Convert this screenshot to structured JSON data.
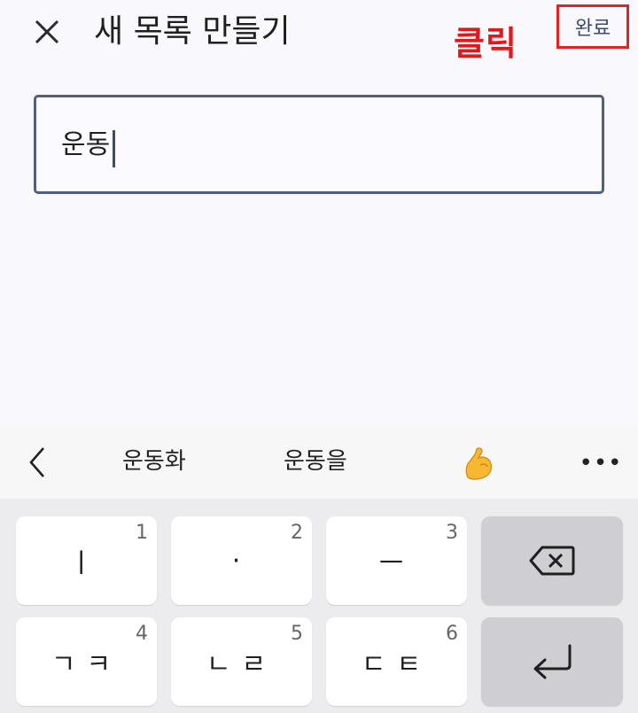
{
  "header": {
    "title": "새 목록 만들기",
    "close_icon": "close-icon",
    "done_label": "완료"
  },
  "annotation": {
    "label": "클릭",
    "color": "#e0191c"
  },
  "input": {
    "value": "운동"
  },
  "suggestions": {
    "back_icon": "chevron-left-icon",
    "items": [
      "운동화",
      "운동을"
    ],
    "emoji": "flexed-biceps-emoji",
    "more": "•••"
  },
  "keyboard": {
    "keys": [
      {
        "num": "1",
        "label": "ㅣ"
      },
      {
        "num": "2",
        "label": "·"
      },
      {
        "num": "3",
        "label": "ㅡ"
      },
      {
        "num": "",
        "label": "backspace-icon"
      },
      {
        "num": "4",
        "label": "ㄱㅋ"
      },
      {
        "num": "5",
        "label": "ㄴㄹ"
      },
      {
        "num": "6",
        "label": "ㄷㅌ"
      },
      {
        "num": "",
        "label": "enter-icon"
      }
    ]
  }
}
